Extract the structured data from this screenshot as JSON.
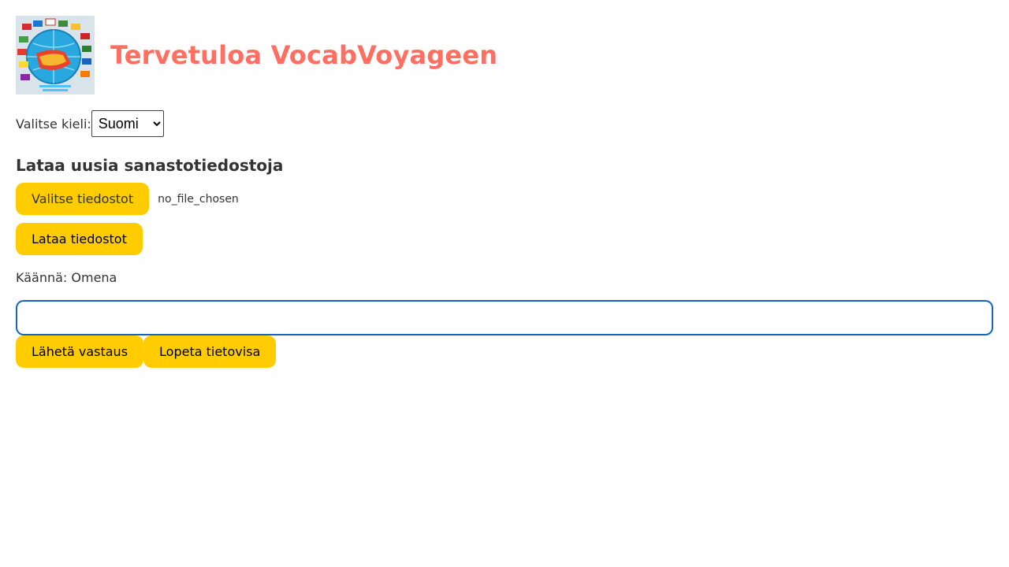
{
  "header": {
    "title": "Tervetuloa VocabVoyageen"
  },
  "language": {
    "label": "Valitse kieli:",
    "selected": "Suomi"
  },
  "upload": {
    "heading": "Lataa uusia sanastotiedostoja",
    "choose_label": "Valitse tiedostot",
    "file_status": "no_file_chosen",
    "upload_label": "Lataa tiedostot"
  },
  "quiz": {
    "prompt": "Käännä: Omena",
    "answer_value": "",
    "submit_label": "Lähetä vastaus",
    "stop_label": "Lopeta tietovisa"
  },
  "colors": {
    "title": "#ff6f61",
    "button": "#ffcc00",
    "input_border": "#1565c0"
  },
  "icons": {
    "logo": "globe-flags-logo"
  }
}
